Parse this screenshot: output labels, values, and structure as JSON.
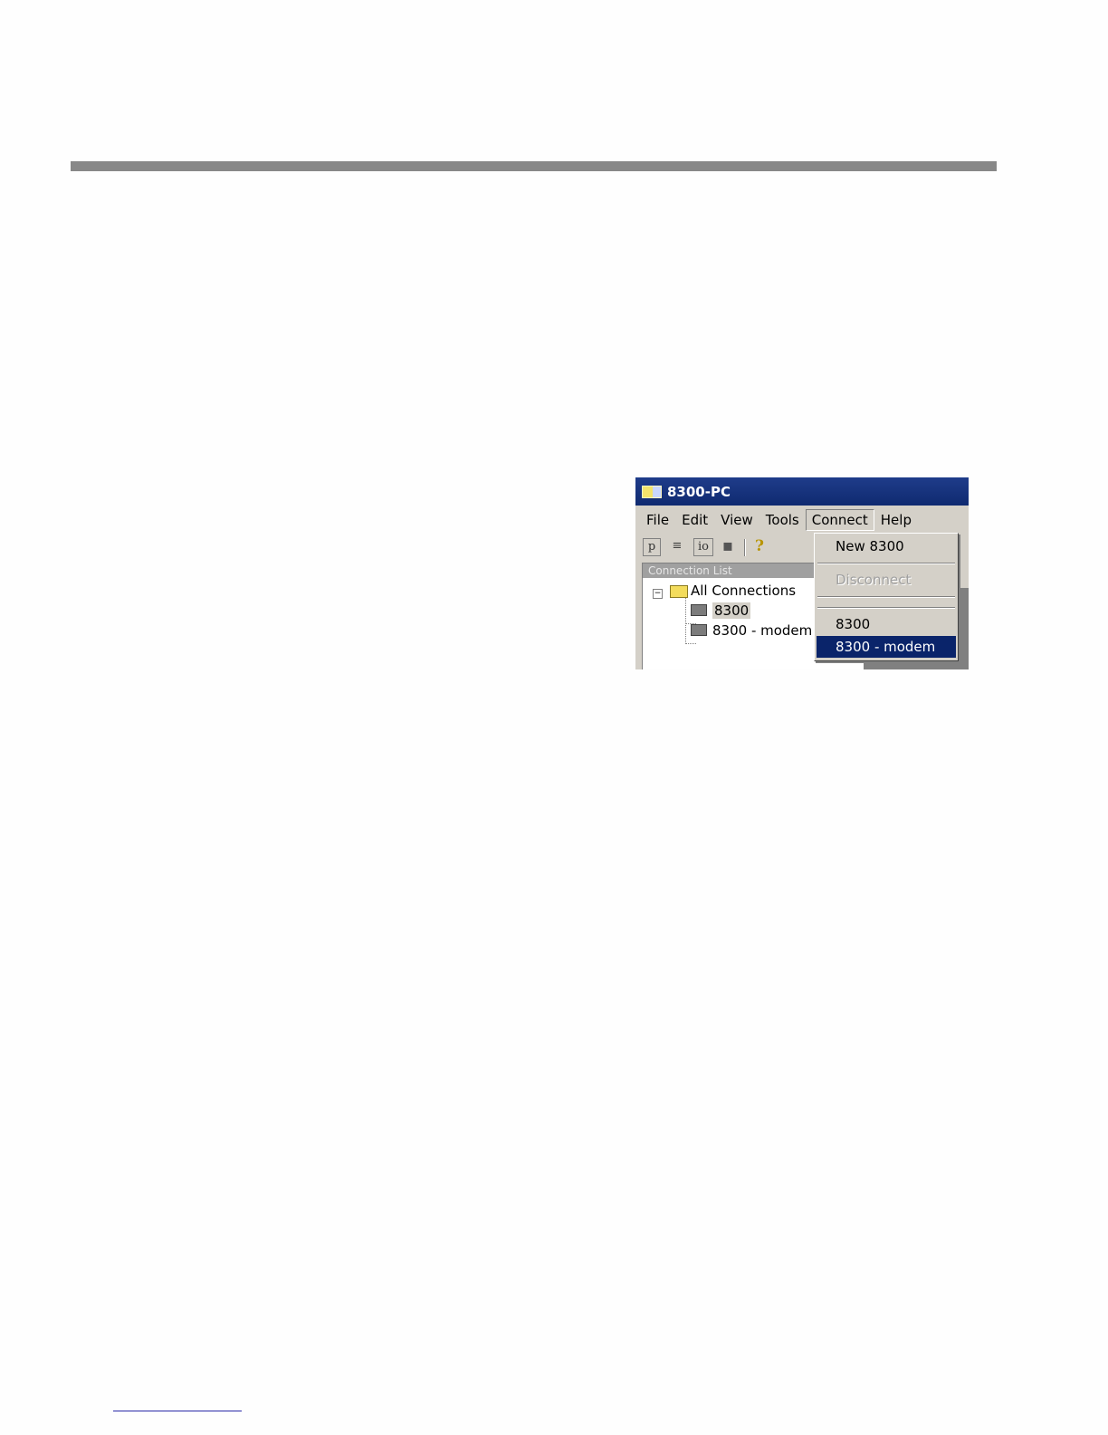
{
  "window": {
    "title": "8300-PC",
    "icon": "app-icon"
  },
  "menubar": [
    "File",
    "Edit",
    "View",
    "Tools",
    "Connect",
    "Help"
  ],
  "toolbar": {
    "buttons": [
      {
        "icon": "p-icon",
        "glyph": "p"
      },
      {
        "icon": "document-icon",
        "glyph": "≡"
      },
      {
        "icon": "io-icon",
        "glyph": "io"
      },
      {
        "icon": "save-icon",
        "glyph": "▪"
      },
      {
        "icon": "help-icon",
        "glyph": "?"
      }
    ]
  },
  "connection_list": {
    "header": "Connection List",
    "root": "All Connections",
    "items": [
      "8300",
      "8300 - modem"
    ]
  },
  "connect_menu": {
    "new": "New 8300",
    "disconnect": "Disconnect",
    "items": [
      "8300",
      "8300 - modem"
    ]
  },
  "colors": {
    "title_bar": "#0f2a70",
    "menu_highlight": "#0a246a",
    "rule": "#888888"
  }
}
